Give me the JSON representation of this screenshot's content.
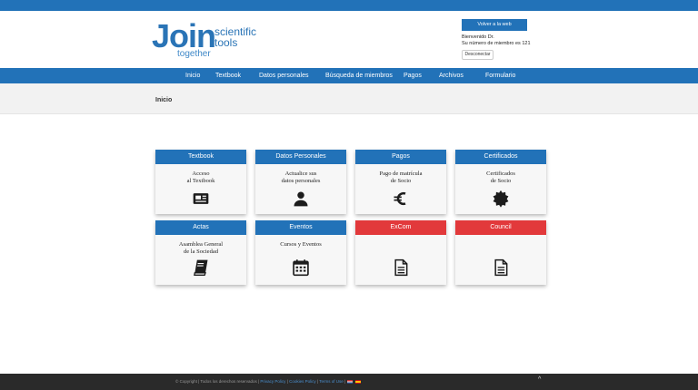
{
  "colors": {
    "primary": "#2272b8",
    "danger": "#e2393b",
    "footer": "#2a2a2a"
  },
  "logo": {
    "word": "Join",
    "line1": "scientific",
    "line2": "tools",
    "tagline": "together"
  },
  "header": {
    "web_button": "Volver a la web",
    "welcome_line1": "Bienvenido Dr.",
    "welcome_line2": "Su número de miembro es 121",
    "logout_button": "Desconectar"
  },
  "nav": {
    "items": [
      {
        "label": "Inicio"
      },
      {
        "label": "Textbook"
      },
      {
        "label": "Datos personales"
      },
      {
        "label": "Búsqueda de miembros"
      },
      {
        "label": "Pagos"
      },
      {
        "label": "Archivos"
      },
      {
        "label": "Formulario"
      }
    ]
  },
  "breadcrumb": {
    "current": "Inicio"
  },
  "cards": [
    {
      "title": "Textbook",
      "line1": "Acceso",
      "line2": "al Textbook",
      "icon": "newspaper-icon",
      "color": "blue"
    },
    {
      "title": "Datos Personales",
      "line1": "Actualice sus",
      "line2": "datos personales",
      "icon": "user-icon",
      "color": "blue"
    },
    {
      "title": "Pagos",
      "line1": "Pago de matrícula",
      "line2": "de Socio",
      "icon": "euro-icon",
      "color": "blue"
    },
    {
      "title": "Certificados",
      "line1": "Certificados",
      "line2": "de Socio",
      "icon": "certificate-icon",
      "color": "blue"
    },
    {
      "title": "Actas",
      "line1": "Asamblea General",
      "line2": "de la Sociedad",
      "icon": "book-icon",
      "color": "blue"
    },
    {
      "title": "Eventos",
      "line1": "Cursos y Eventos",
      "line2": "",
      "icon": "calendar-icon",
      "color": "blue"
    },
    {
      "title": "ExCom",
      "line1": "",
      "line2": "",
      "icon": "document-icon",
      "color": "red"
    },
    {
      "title": "Council",
      "line1": "",
      "line2": "",
      "icon": "document-icon",
      "color": "red"
    }
  ],
  "footer": {
    "copyright": "© Copyright",
    "rights": "| Todos los derechos reservados |",
    "privacy": "Privacy Policy",
    "cookies": "Cookies Policy",
    "terms": "Terms of Use",
    "sep": "|",
    "to_top": "^"
  }
}
